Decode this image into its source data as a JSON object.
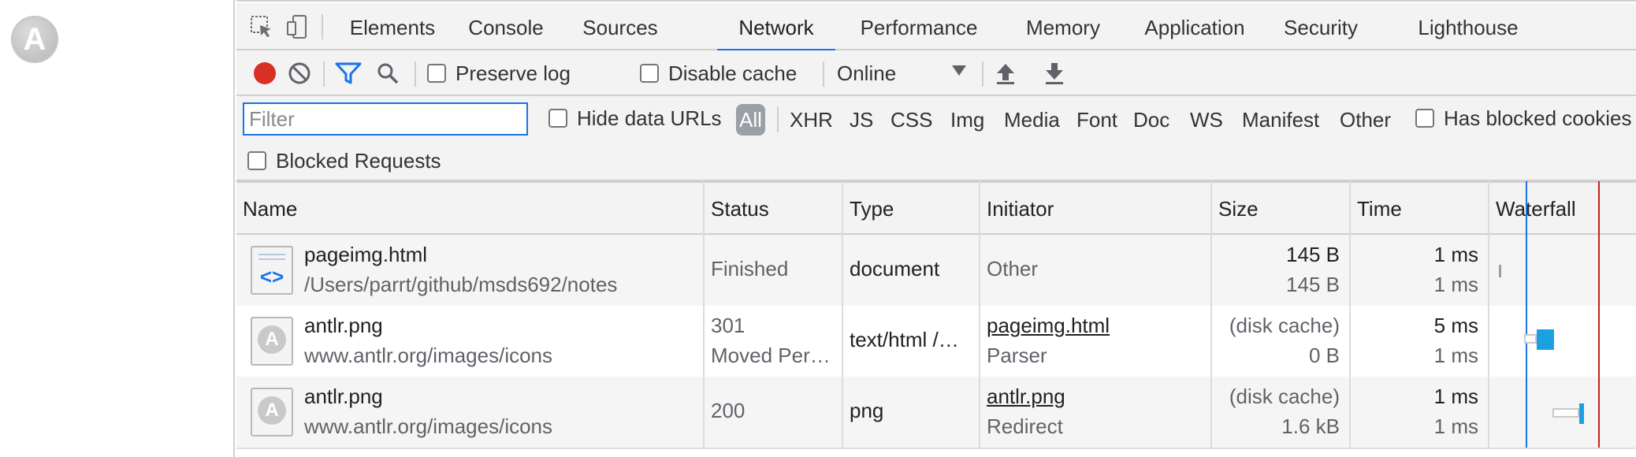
{
  "page": {
    "logo_letter": "A"
  },
  "tabs": [
    {
      "label": "Elements"
    },
    {
      "label": "Console"
    },
    {
      "label": "Sources"
    },
    {
      "label": "Network"
    },
    {
      "label": "Performance"
    },
    {
      "label": "Memory"
    },
    {
      "label": "Application"
    },
    {
      "label": "Security"
    },
    {
      "label": "Lighthouse"
    }
  ],
  "active_tab": "Network",
  "toolbar": {
    "preserve_log": "Preserve log",
    "disable_cache": "Disable cache",
    "throttle": "Online"
  },
  "filterbar": {
    "filter_placeholder": "Filter",
    "hide_data_urls": "Hide data URLs",
    "types": [
      "All",
      "XHR",
      "JS",
      "CSS",
      "Img",
      "Media",
      "Font",
      "Doc",
      "WS",
      "Manifest",
      "Other"
    ],
    "active_type": "All",
    "has_blocked_cookies": "Has blocked cookies",
    "blocked_requests": "Blocked Requests"
  },
  "table": {
    "columns": [
      "Name",
      "Status",
      "Type",
      "Initiator",
      "Size",
      "Time",
      "Waterfall"
    ],
    "rows": [
      {
        "icon": "document-icon",
        "name": "pageimg.html",
        "path": "/Users/parrt/github/msds692/notes",
        "status": "Finished",
        "status2": "",
        "type": "document",
        "initiator": "Other",
        "initiator2": "",
        "size": "145 B",
        "size2": "145 B",
        "time": "1 ms",
        "time2": "1 ms"
      },
      {
        "icon": "image-icon",
        "name": "antlr.png",
        "path": "www.antlr.org/images/icons",
        "status": "301",
        "status2": "Moved Per…",
        "type": "text/html /…",
        "initiator": "pageimg.html",
        "initiator2": "Parser",
        "size": "(disk cache)",
        "size2": "0 B",
        "time": "5 ms",
        "time2": "1 ms"
      },
      {
        "icon": "image-icon",
        "name": "antlr.png",
        "path": "www.antlr.org/images/icons",
        "status": "200",
        "status2": "",
        "type": "png",
        "initiator": "antlr.png",
        "initiator2": "Redirect",
        "size": "(disk cache)",
        "size2": "1.6 kB",
        "time": "1 ms",
        "time2": "1 ms"
      }
    ]
  },
  "colors": {
    "accent": "#1a73e8",
    "record": "#d93025",
    "dom_content_loaded": "#1a73e8",
    "load_event": "#c5221f",
    "waterfall_bar": "#1ba1e2"
  }
}
